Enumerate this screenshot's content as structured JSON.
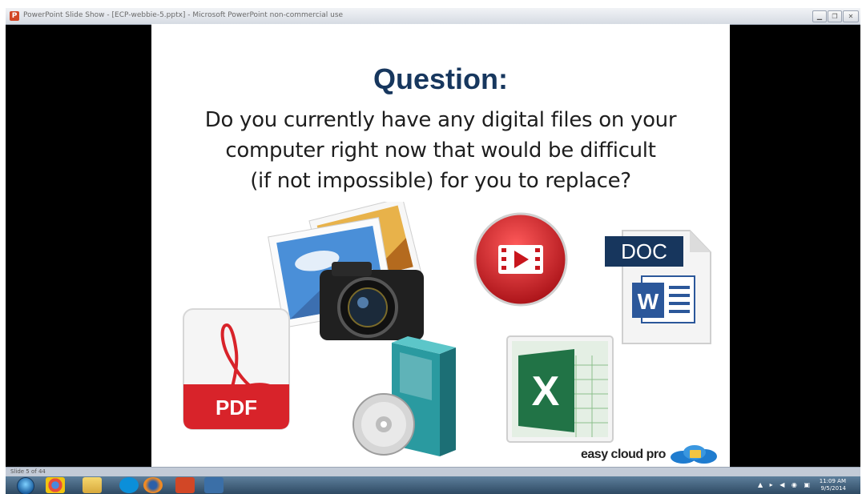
{
  "window": {
    "title": "PowerPoint Slide Show - [ECP-webbie-5.pptx] - Microsoft PowerPoint non-commercial use",
    "app_icon": "P",
    "controls": [
      "minimize-icon",
      "restore-icon",
      "close-icon"
    ]
  },
  "slide": {
    "title": "Question:",
    "question_lines": [
      "Do you currently have any digital files on your",
      "computer right now that would be difficult",
      "(if not impossible) for you to replace?"
    ],
    "doc_label": "DOC",
    "word_letter": "W",
    "pdf_label": "PDF",
    "excel_letter": "X",
    "brand": "easy cloud pro"
  },
  "status": {
    "slide_counter": "Slide 5 of 44"
  },
  "taskbar": {
    "time": "11:09 AM",
    "date": "9/5/2014",
    "apps": [
      "chrome-icon",
      "folder-icon",
      "skype-icon",
      "firefox-icon",
      "powerpoint-icon",
      "snowflake-icon"
    ]
  },
  "colors": {
    "title": "#17375e",
    "pdf_red": "#d8232a",
    "doc_navy": "#17365d",
    "excel_green": "#217346",
    "video_red": "#c8161d"
  }
}
